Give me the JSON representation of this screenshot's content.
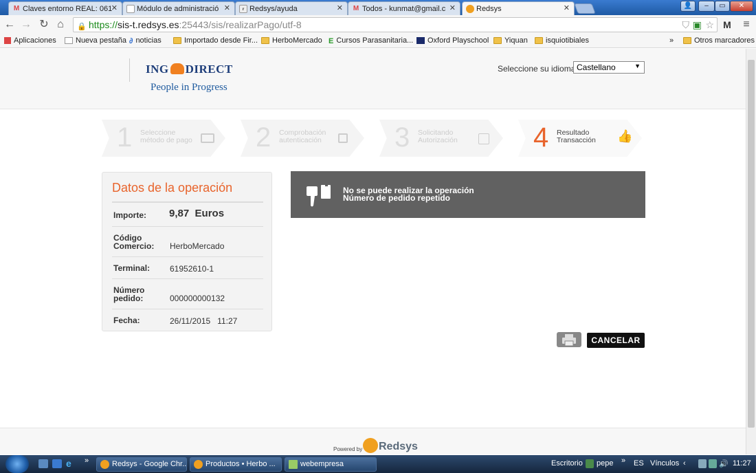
{
  "browser": {
    "tabs": [
      {
        "title": "Claves entorno REAL: 061",
        "icon": "gmail-icon"
      },
      {
        "title": "Módulo de administració",
        "icon": "page-icon"
      },
      {
        "title": "Redsys/ayuda",
        "icon": "redsys-icon"
      },
      {
        "title": "Todos - kunmat@gmail.c",
        "icon": "gmail-icon"
      },
      {
        "title": "Redsys",
        "icon": "chrome-icon"
      }
    ],
    "url_scheme": "https://",
    "url_host": "sis-t.redsys.es",
    "url_path": ":25443/sis/realizarPago/utf-8",
    "bookmarks": [
      {
        "label": "Aplicaciones",
        "icon": "apps-icon"
      },
      {
        "label": "Nueva pestaña",
        "icon": "page-icon"
      },
      {
        "label": "noticias",
        "icon": "ad-icon"
      },
      {
        "label": "Importado desde Fir...",
        "icon": "folder-icon"
      },
      {
        "label": "HerboMercado",
        "icon": "folder-icon"
      },
      {
        "label": "Cursos Parasanitaria...",
        "icon": "e-icon"
      },
      {
        "label": "Oxford Playschool",
        "icon": "oup-icon"
      },
      {
        "label": "Yiquan",
        "icon": "folder-icon"
      },
      {
        "label": "isquiotibiales",
        "icon": "folder-icon"
      }
    ],
    "bookmarks_more": "»",
    "other_bookmarks": "Otros marcadores"
  },
  "header": {
    "logo_line1_a": "ING",
    "logo_line1_b": "DIRECT",
    "logo_line2": "People in Progress",
    "language_label": "Seleccione su idioma",
    "language_value": "Castellano"
  },
  "steps": [
    {
      "num": "1",
      "label1": "Seleccione",
      "label2": "método de pago",
      "icon": "card-icon"
    },
    {
      "num": "2",
      "label1": "Comprobación",
      "label2": "autenticación",
      "icon": "lock-icon"
    },
    {
      "num": "3",
      "label1": "Solicitando",
      "label2": "Autorización",
      "icon": "transfer-icon"
    },
    {
      "num": "4",
      "label1": "Resultado",
      "label2": "Transacción",
      "icon": "thumbs-up-icon"
    }
  ],
  "operation": {
    "title": "Datos de la operación",
    "importe_label": "Importe:",
    "importe_value": "9,87  Euros",
    "comercio_label1": "Código",
    "comercio_label2": "Comercio:",
    "comercio_value": "HerboMercado",
    "terminal_label": "Terminal:",
    "terminal_value": "61952610-1",
    "pedido_label1": "Número",
    "pedido_label2": "pedido:",
    "pedido_value": "000000000132",
    "fecha_label": "Fecha:",
    "fecha_value": "26/11/2015   11:27"
  },
  "message": {
    "line1": "No se puede realizar la operación",
    "line2": "Número de pedido repetido"
  },
  "actions": {
    "cancel_label": "CANCELAR"
  },
  "footer": {
    "powered_by": "Powered by",
    "brand": "Redsys"
  },
  "taskbar": {
    "apps": [
      {
        "label": "Redsys - Google Chr...",
        "icon": "chrome-icon"
      },
      {
        "label": "Productos • Herbo ...",
        "icon": "chrome-icon"
      },
      {
        "label": "webempresa",
        "icon": "notepad-icon"
      }
    ],
    "tray_escritorio": "Escritorio",
    "tray_user": "pepe",
    "tray_lang": "ES",
    "tray_vinculos": "Vínculos",
    "clock": "11:27"
  }
}
